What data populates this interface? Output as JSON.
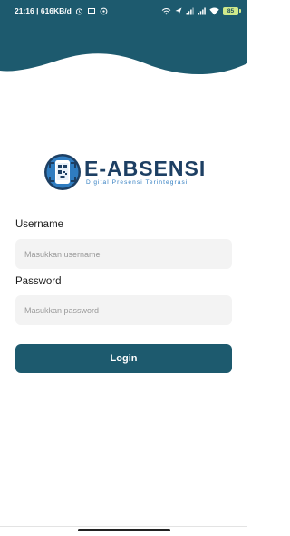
{
  "status_bar": {
    "time_info": "21:16 | 616KB/d",
    "battery": "85",
    "icons": [
      "alarm-icon",
      "laptop-icon",
      "whatsapp-icon",
      "wifi-call-icon",
      "location-icon",
      "signal-icon",
      "signal-icon",
      "wifi-icon",
      "battery-icon"
    ]
  },
  "colors": {
    "header": "#1d5a6e",
    "button": "#1d5a6e",
    "field_bg": "#f3f3f3",
    "logo_text": "#1d3f63",
    "logo_sub": "#2f7cc0"
  },
  "logo": {
    "title": "E-ABSENSI",
    "subtitle": "Digital Presensi Terintegrasi"
  },
  "form": {
    "username_label": "Username",
    "username_placeholder": "Masukkan username",
    "username_value": "",
    "password_label": "Password",
    "password_placeholder": "Masukkan password",
    "password_value": "",
    "login_label": "Login"
  }
}
